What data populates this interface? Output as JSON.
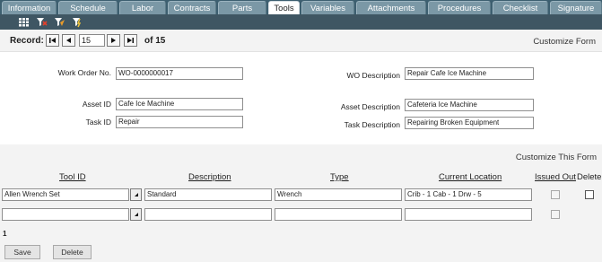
{
  "tabs": [
    {
      "label": "Information",
      "active": false
    },
    {
      "label": "Schedule",
      "active": false
    },
    {
      "label": "Labor",
      "active": false
    },
    {
      "label": "Contracts",
      "active": false
    },
    {
      "label": "Parts",
      "active": false
    },
    {
      "label": "Tools",
      "active": true
    },
    {
      "label": "Variables",
      "active": false
    },
    {
      "label": "Attachments",
      "active": false
    },
    {
      "label": "Procedures",
      "active": false
    },
    {
      "label": "Checklist",
      "active": false
    },
    {
      "label": "Signature",
      "active": false
    }
  ],
  "toolbar": {
    "icons": [
      "grid-icon",
      "filter-icon",
      "filter-add-icon",
      "filter-clear-icon"
    ]
  },
  "record": {
    "label": "Record:",
    "value": "15",
    "of_text": "of 15",
    "customize_label": "Customize Form"
  },
  "form": {
    "work_order_label": "Work Order No.",
    "work_order_value": "WO-0000000017",
    "wo_description_label": "WO Description",
    "wo_description_value": "Repair Cafe Ice Machine",
    "asset_id_label": "Asset ID",
    "asset_id_value": "Cafe Ice Machine",
    "asset_description_label": "Asset Description",
    "asset_description_value": "Cafeteria Ice Machine",
    "task_id_label": "Task ID",
    "task_id_value": "Repair",
    "task_description_label": "Task Description",
    "task_description_value": "Repairing Broken Equipment"
  },
  "grid": {
    "customize_label": "Customize This Form",
    "headers": {
      "tool_id": "Tool ID",
      "description": "Description",
      "type": "Type",
      "current_location": "Current Location",
      "issued_out": "Issued Out",
      "delete": "Delete"
    },
    "rows": [
      {
        "tool_id": "Allen Wrench Set",
        "description": "Standard",
        "type": "Wrench",
        "current_location": "Crib - 1 Cab - 1 Drw - 5",
        "issued_out": false,
        "delete": false
      },
      {
        "tool_id": "",
        "description": "",
        "type": "",
        "current_location": "",
        "issued_out": false
      }
    ],
    "page_number": "1"
  },
  "buttons": {
    "save": "Save",
    "delete": "Delete"
  }
}
